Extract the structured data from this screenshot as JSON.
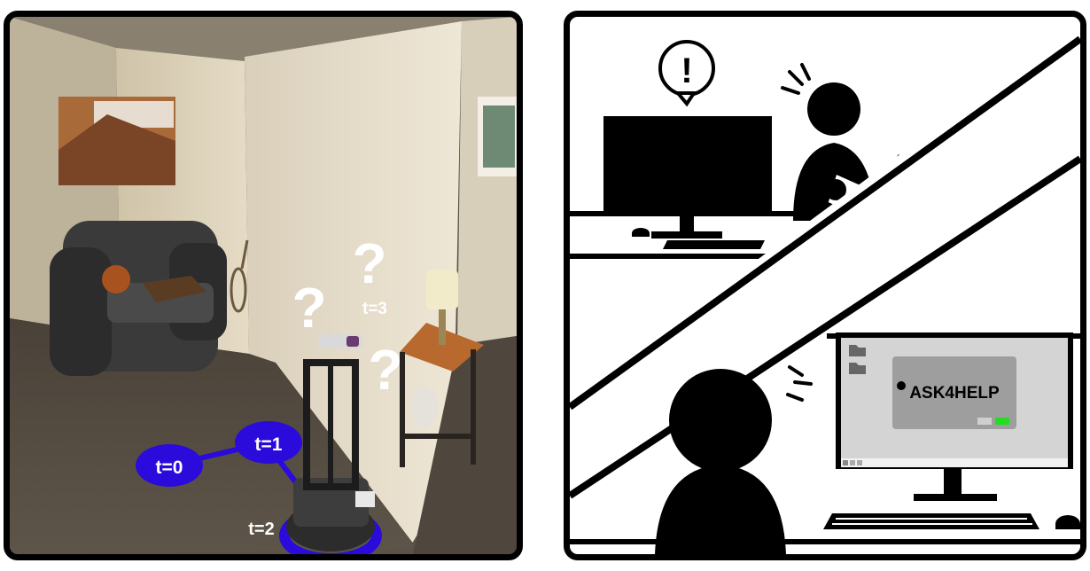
{
  "left_panel": {
    "timesteps": [
      "t=0",
      "t=1",
      "t=2",
      "t=3"
    ],
    "question_marks": [
      "?",
      "?",
      "?"
    ]
  },
  "right_panel": {
    "alert_symbol": "!",
    "monitor_app_name": "ASK4HELP",
    "colors": {
      "accent_green": "#22dd22",
      "robot_path_blue": "#2a0bdc"
    }
  }
}
